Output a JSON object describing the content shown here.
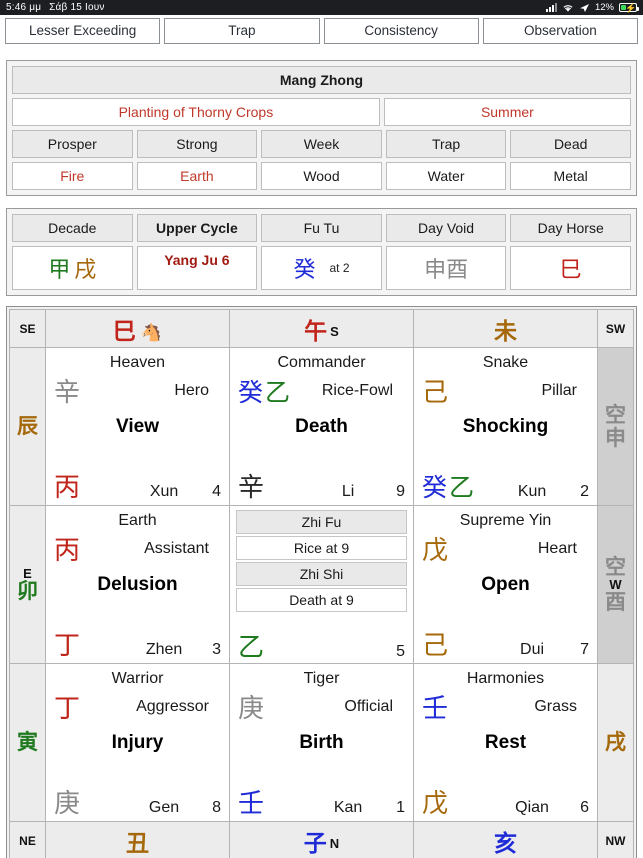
{
  "statusbar": {
    "time": "5:46 μμ",
    "date": "Σάβ 15 Ιουν",
    "battery_percent": "12%",
    "icons": [
      "signal-icon",
      "wifi-icon",
      "location-arrow-icon",
      "battery-charging-icon"
    ]
  },
  "tabs": [
    {
      "label": "Lesser Exceeding",
      "active": true
    },
    {
      "label": "Trap",
      "active": false
    },
    {
      "label": "Consistency",
      "active": false
    },
    {
      "label": "Observation",
      "active": false
    }
  ],
  "solar_term_panel": {
    "title": "Mang Zhong",
    "subtitle_left": "Planting of Thorny Crops",
    "subtitle_right": "Summer",
    "strength_headers": [
      "Prosper",
      "Strong",
      "Week",
      "Trap",
      "Dead"
    ],
    "strength_values": [
      "Fire",
      "Earth",
      "Wood",
      "Water",
      "Metal"
    ],
    "red_value_indices": [
      0,
      1
    ]
  },
  "cycle_panel": {
    "headers": [
      "Decade",
      "Upper Cycle",
      "Fu Tu",
      "Day Void",
      "Day Horse"
    ],
    "decade": {
      "stem": "甲",
      "branch": "戌"
    },
    "upper_cycle": "Yang Ju 6",
    "fu_tu": {
      "stem": "癸",
      "note": "at 2"
    },
    "day_void": "申酉",
    "day_horse": "巳"
  },
  "chart": {
    "corners": {
      "top_left": "SE",
      "top_right": "SW",
      "bottom_left": "NE",
      "bottom_right": "NW"
    },
    "edges_top": [
      {
        "han": "巳",
        "color": "red",
        "dir": "",
        "icon": "horse-icon"
      },
      {
        "han": "午",
        "color": "red",
        "dir": "S",
        "icon": ""
      },
      {
        "han": "未",
        "color": "brown",
        "dir": "",
        "icon": ""
      }
    ],
    "edges_bottom": [
      {
        "han": "丑",
        "color": "brown",
        "dir": ""
      },
      {
        "han": "子",
        "color": "blue",
        "dir": "N"
      },
      {
        "han": "亥",
        "color": "blue",
        "dir": ""
      }
    ],
    "edges_left": [
      {
        "han": "辰",
        "color": "brown",
        "dir": ""
      },
      {
        "han": "卯",
        "color": "green",
        "dir": "E"
      },
      {
        "han": "寅",
        "color": "green",
        "dir": ""
      }
    ],
    "edges_right": [
      {
        "han": "申",
        "color": "gray",
        "dir": "",
        "void": "空",
        "shaded": true
      },
      {
        "han": "酉",
        "color": "gray",
        "dir": "W",
        "void": "空",
        "shaded": true
      },
      {
        "han": "戌",
        "color": "brown",
        "dir": "",
        "void": "",
        "shaded": false
      }
    ],
    "palaces": [
      {
        "spirit": "Heaven",
        "star": "Hero",
        "door": "View",
        "heaven_stems": [
          {
            "c": "辛",
            "color": "gray"
          }
        ],
        "earth_stems": [
          {
            "c": "丙",
            "color": "red"
          }
        ],
        "trigram": "Xun",
        "number": "4"
      },
      {
        "spirit": "Commander",
        "star": "Rice-Fowl",
        "door": "Death",
        "heaven_stems": [
          {
            "c": "癸",
            "color": "blue"
          },
          {
            "c": "乙",
            "color": "green"
          }
        ],
        "earth_stems": [
          {
            "c": "辛",
            "color": "dark"
          }
        ],
        "trigram": "Li",
        "number": "9"
      },
      {
        "spirit": "Snake",
        "star": "Pillar",
        "door": "Shocking",
        "heaven_stems": [
          {
            "c": "己",
            "color": "brown"
          }
        ],
        "earth_stems": [
          {
            "c": "癸",
            "color": "blue"
          },
          {
            "c": "乙",
            "color": "green"
          }
        ],
        "trigram": "Kun",
        "number": "2"
      },
      {
        "spirit": "Earth",
        "star": "Assistant",
        "door": "Delusion",
        "heaven_stems": [
          {
            "c": "丙",
            "color": "red"
          }
        ],
        "earth_stems": [
          {
            "c": "丁",
            "color": "red"
          }
        ],
        "trigram": "Zhen",
        "number": "3"
      },
      {
        "center": true,
        "rows": [
          {
            "label": "Zhi Fu",
            "type": "header"
          },
          {
            "label": "Rice at 9",
            "type": "value"
          },
          {
            "label": "Zhi Shi",
            "type": "header"
          },
          {
            "label": "Death at 9",
            "type": "value"
          }
        ],
        "earth_stems": [
          {
            "c": "乙",
            "color": "green"
          }
        ],
        "number": "5"
      },
      {
        "spirit": "Supreme Yin",
        "star": "Heart",
        "door": "Open",
        "heaven_stems": [
          {
            "c": "戊",
            "color": "brown"
          }
        ],
        "earth_stems": [
          {
            "c": "己",
            "color": "brown"
          }
        ],
        "trigram": "Dui",
        "number": "7"
      },
      {
        "spirit": "Warrior",
        "star": "Aggressor",
        "door": "Injury",
        "heaven_stems": [
          {
            "c": "丁",
            "color": "red"
          }
        ],
        "earth_stems": [
          {
            "c": "庚",
            "color": "gray"
          }
        ],
        "trigram": "Gen",
        "number": "8"
      },
      {
        "spirit": "Tiger",
        "star": "Official",
        "door": "Birth",
        "heaven_stems": [
          {
            "c": "庚",
            "color": "gray"
          }
        ],
        "earth_stems": [
          {
            "c": "壬",
            "color": "blue"
          }
        ],
        "trigram": "Kan",
        "number": "1"
      },
      {
        "spirit": "Harmonies",
        "star": "Grass",
        "door": "Rest",
        "heaven_stems": [
          {
            "c": "壬",
            "color": "blue"
          }
        ],
        "earth_stems": [
          {
            "c": "戊",
            "color": "brown"
          }
        ],
        "trigram": "Qian",
        "number": "6"
      }
    ]
  },
  "colors": {
    "red": "#c0241b",
    "green": "#1f7a1f",
    "brown": "#a5690b",
    "blue": "#1f2bd6",
    "gray": "#8a8a8a",
    "accent_dark_red": "#a01b12"
  }
}
